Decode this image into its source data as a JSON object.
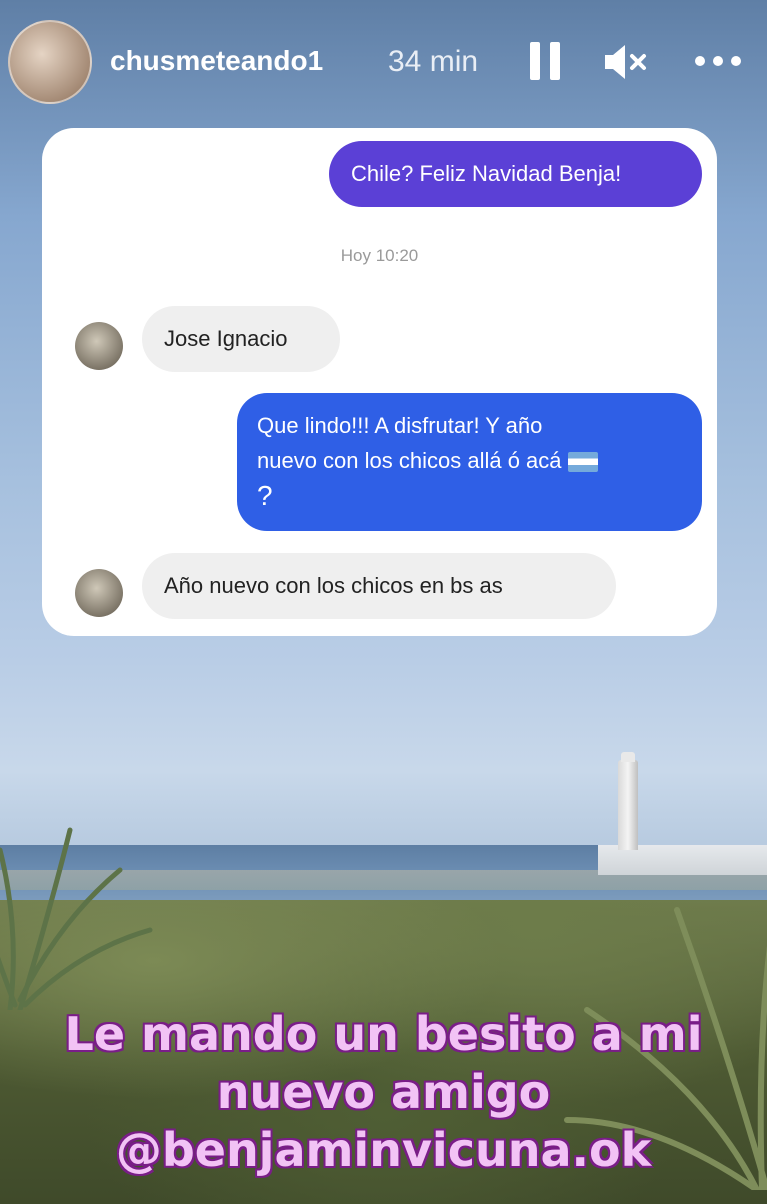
{
  "header": {
    "username": "chusmeteando1",
    "time": "34 min"
  },
  "chat": {
    "outgoing_1": "Chile? Feliz Navidad Benja!",
    "timestamp": "Hoy 10:20",
    "incoming_1": "Jose Ignacio",
    "outgoing_2_line1": "Que lindo!!! A disfrutar! Y año",
    "outgoing_2_line2": "nuevo con los chicos allá ó acá",
    "outgoing_2_line3": "?",
    "incoming_2": "Año nuevo con los chicos en bs  as"
  },
  "story_caption": {
    "line1": "Le mando un besito a mi",
    "line2": "nuevo amigo",
    "line3": "@benjaminvicuna.ok"
  },
  "icons": {
    "pause": "pause-icon",
    "mute": "mute-icon",
    "more": "more-icon",
    "flag": "argentina-flag-icon"
  }
}
